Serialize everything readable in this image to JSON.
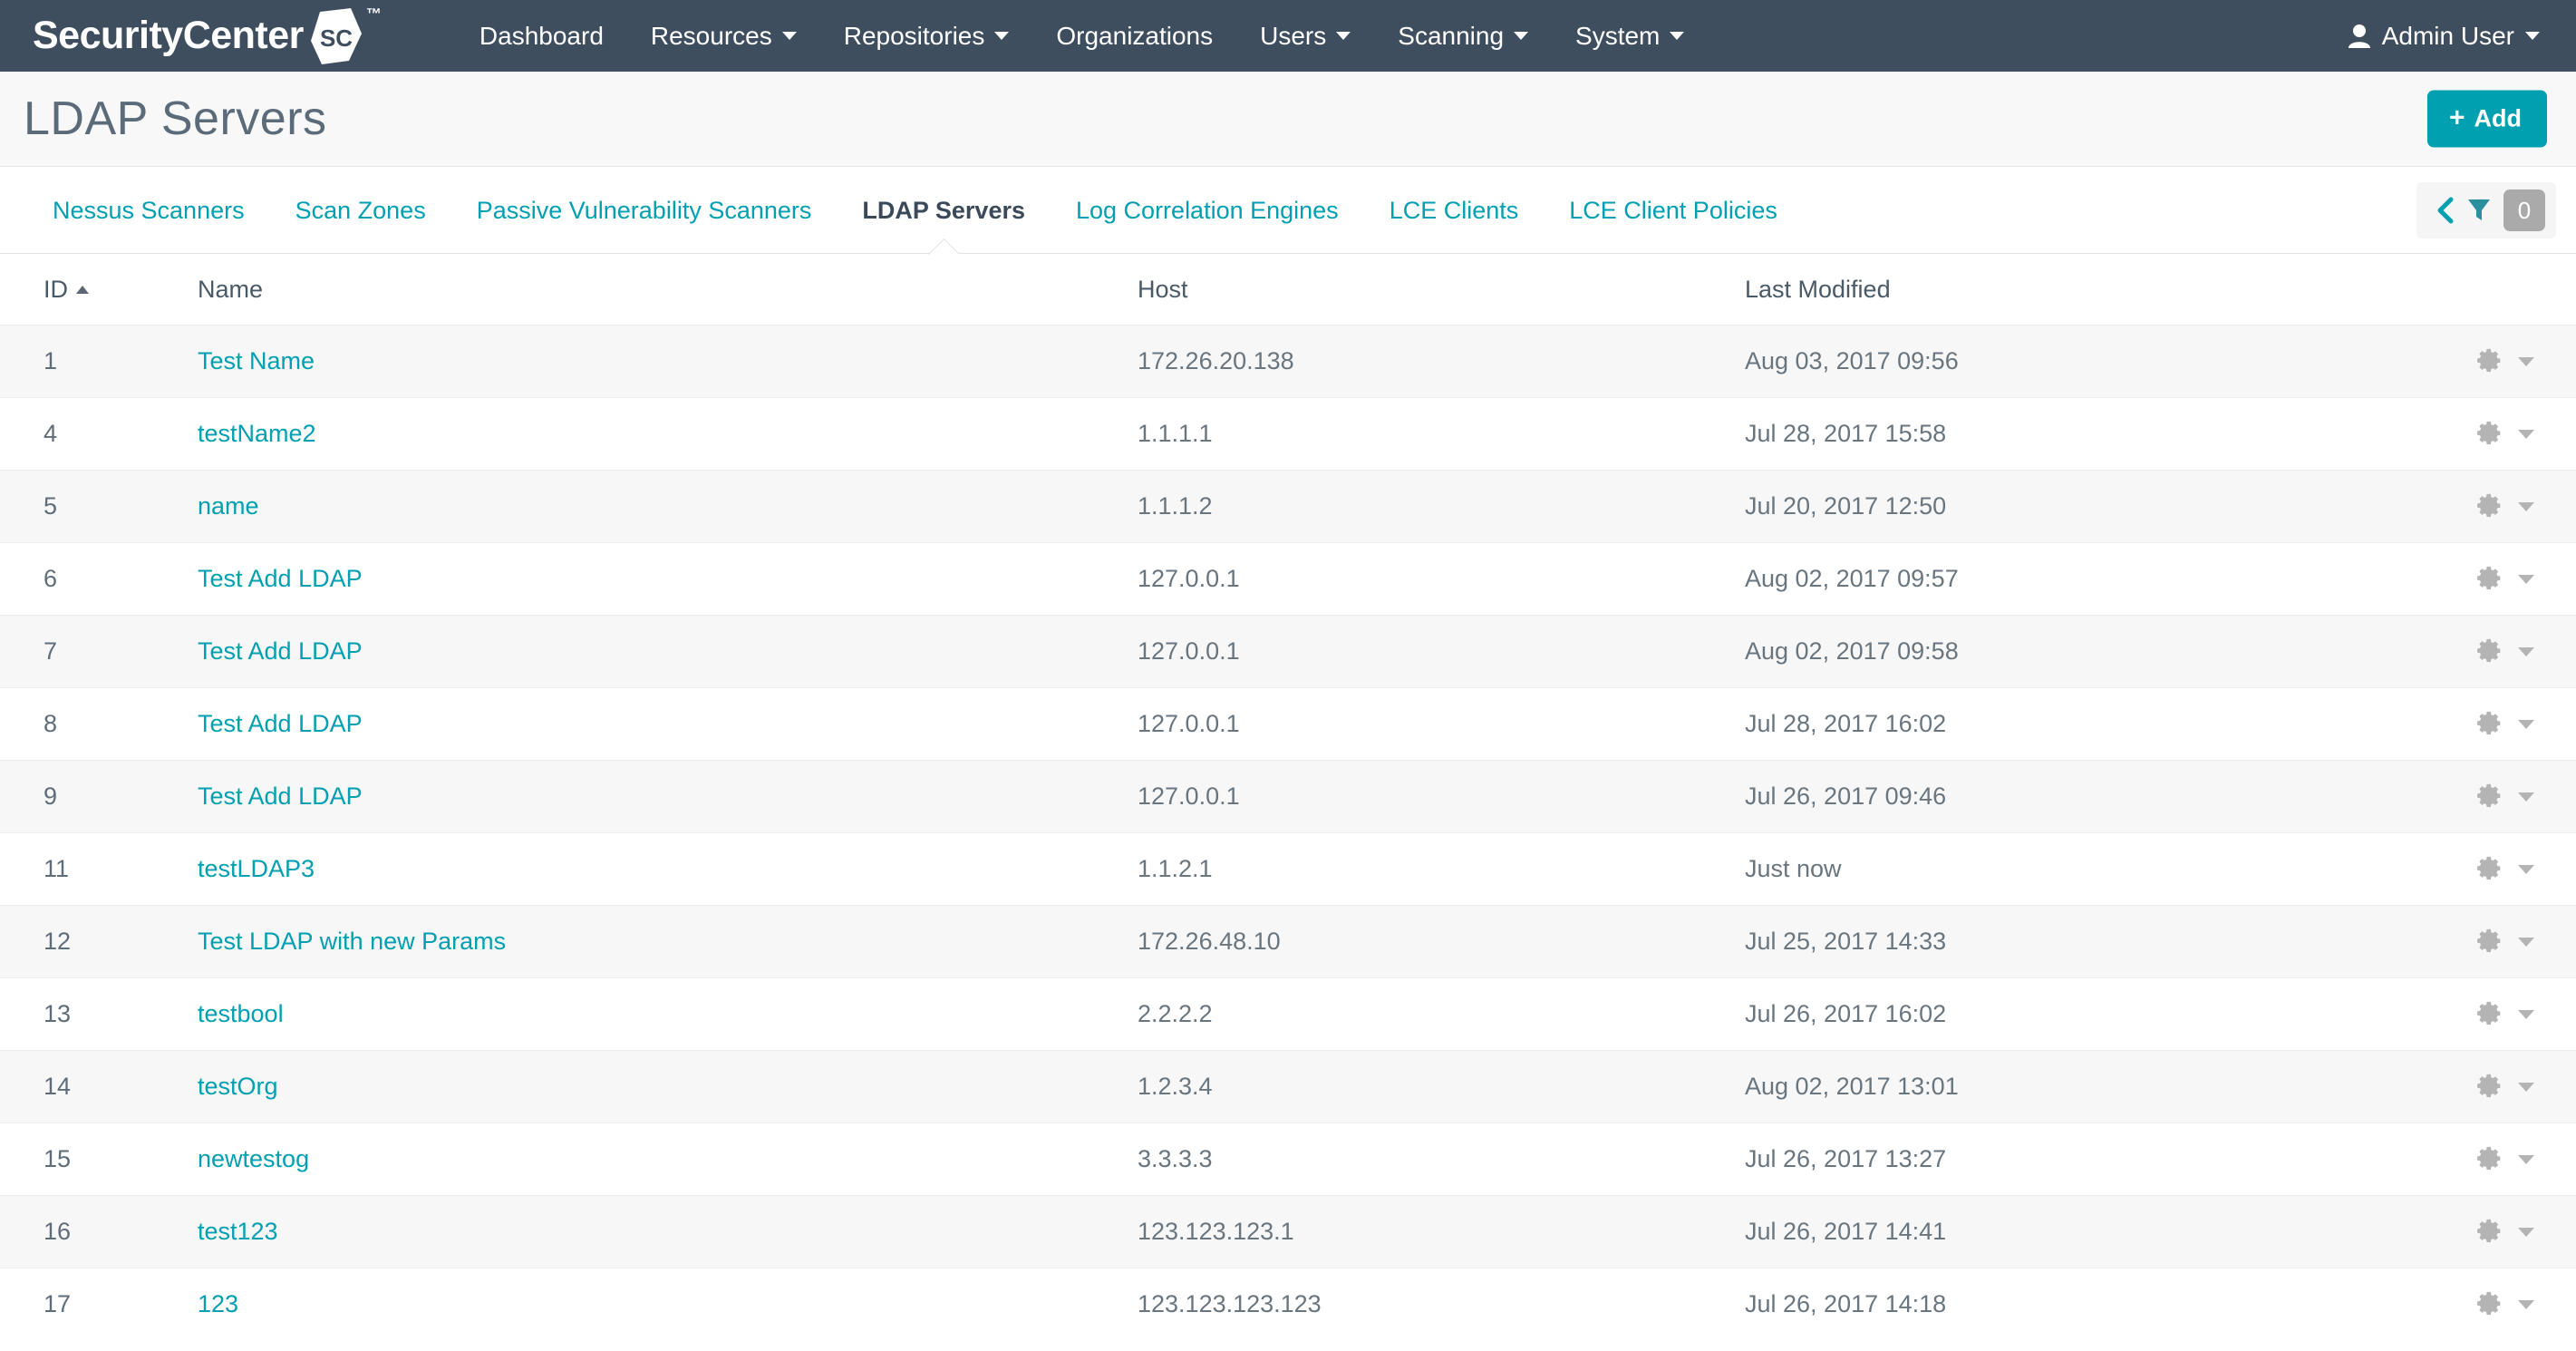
{
  "header": {
    "brand_text": "SecurityCenter",
    "brand_badge": "SC",
    "trademark": "™",
    "nav": [
      {
        "label": "Dashboard",
        "has_caret": false
      },
      {
        "label": "Resources",
        "has_caret": true
      },
      {
        "label": "Repositories",
        "has_caret": true
      },
      {
        "label": "Organizations",
        "has_caret": false
      },
      {
        "label": "Users",
        "has_caret": true
      },
      {
        "label": "Scanning",
        "has_caret": true
      },
      {
        "label": "System",
        "has_caret": true
      }
    ],
    "user": "Admin User"
  },
  "page": {
    "title": "LDAP Servers",
    "add_label": "Add",
    "add_plus": "+"
  },
  "tabs": [
    {
      "label": "Nessus Scanners",
      "active": false
    },
    {
      "label": "Scan Zones",
      "active": false
    },
    {
      "label": "Passive Vulnerability Scanners",
      "active": false
    },
    {
      "label": "LDAP Servers",
      "active": true
    },
    {
      "label": "Log Correlation Engines",
      "active": false
    },
    {
      "label": "LCE Clients",
      "active": false
    },
    {
      "label": "LCE Client Policies",
      "active": false
    }
  ],
  "filter": {
    "count": "0"
  },
  "table": {
    "columns": {
      "id": "ID",
      "name": "Name",
      "host": "Host",
      "modified": "Last Modified"
    },
    "sort": {
      "column": "ID",
      "direction": "asc"
    },
    "rows": [
      {
        "id": "1",
        "name": "Test Name",
        "host": "172.26.20.138",
        "modified": "Aug 03, 2017 09:56"
      },
      {
        "id": "4",
        "name": "testName2",
        "host": "1.1.1.1",
        "modified": "Jul 28, 2017 15:58"
      },
      {
        "id": "5",
        "name": "name",
        "host": "1.1.1.2",
        "modified": "Jul 20, 2017 12:50"
      },
      {
        "id": "6",
        "name": "Test Add LDAP",
        "host": "127.0.0.1",
        "modified": "Aug 02, 2017 09:57"
      },
      {
        "id": "7",
        "name": "Test Add LDAP",
        "host": "127.0.0.1",
        "modified": "Aug 02, 2017 09:58"
      },
      {
        "id": "8",
        "name": "Test Add LDAP",
        "host": "127.0.0.1",
        "modified": "Jul 28, 2017 16:02"
      },
      {
        "id": "9",
        "name": "Test Add LDAP",
        "host": "127.0.0.1",
        "modified": "Jul 26, 2017 09:46"
      },
      {
        "id": "11",
        "name": "testLDAP3",
        "host": "1.1.2.1",
        "modified": "Just now"
      },
      {
        "id": "12",
        "name": "Test LDAP with new Params",
        "host": "172.26.48.10",
        "modified": "Jul 25, 2017 14:33"
      },
      {
        "id": "13",
        "name": "testbool",
        "host": "2.2.2.2",
        "modified": "Jul 26, 2017 16:02"
      },
      {
        "id": "14",
        "name": "testOrg",
        "host": "1.2.3.4",
        "modified": "Aug 02, 2017 13:01"
      },
      {
        "id": "15",
        "name": "newtestog",
        "host": "3.3.3.3",
        "modified": "Jul 26, 2017 13:27"
      },
      {
        "id": "16",
        "name": "test123",
        "host": "123.123.123.1",
        "modified": "Jul 26, 2017 14:41"
      },
      {
        "id": "17",
        "name": "123",
        "host": "123.123.123.123",
        "modified": "Jul 26, 2017 14:18"
      }
    ]
  },
  "colors": {
    "header_bg": "#3f4e5e",
    "accent_teal": "#009fb2",
    "add_button": "#00a0b0",
    "row_alt": "#f7f7f7",
    "text_dark": "#3b4a5a"
  }
}
